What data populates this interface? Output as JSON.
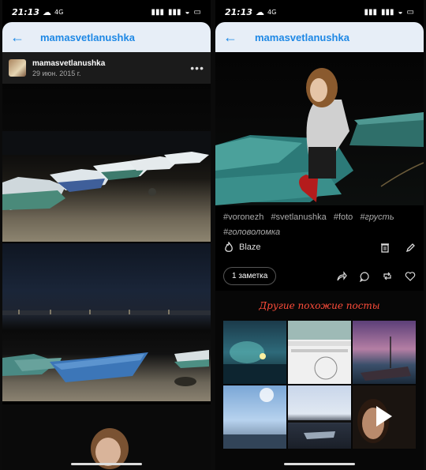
{
  "status": {
    "time": "21:13",
    "carrier": "4G"
  },
  "left": {
    "header": {
      "title": "mamasvetlanushka"
    },
    "post": {
      "username": "mamasvetlanushka",
      "date": "29 июн. 2015 г."
    }
  },
  "right": {
    "header": {
      "title": "mamasvetlanushka"
    },
    "tags": [
      "#voronezh",
      "#svetlanushka",
      "#foto",
      "#грусть",
      "#головоломка"
    ],
    "blaze_label": "Blaze",
    "notes_label": "1 заметка",
    "similar_title": "Другие похожие посты"
  }
}
